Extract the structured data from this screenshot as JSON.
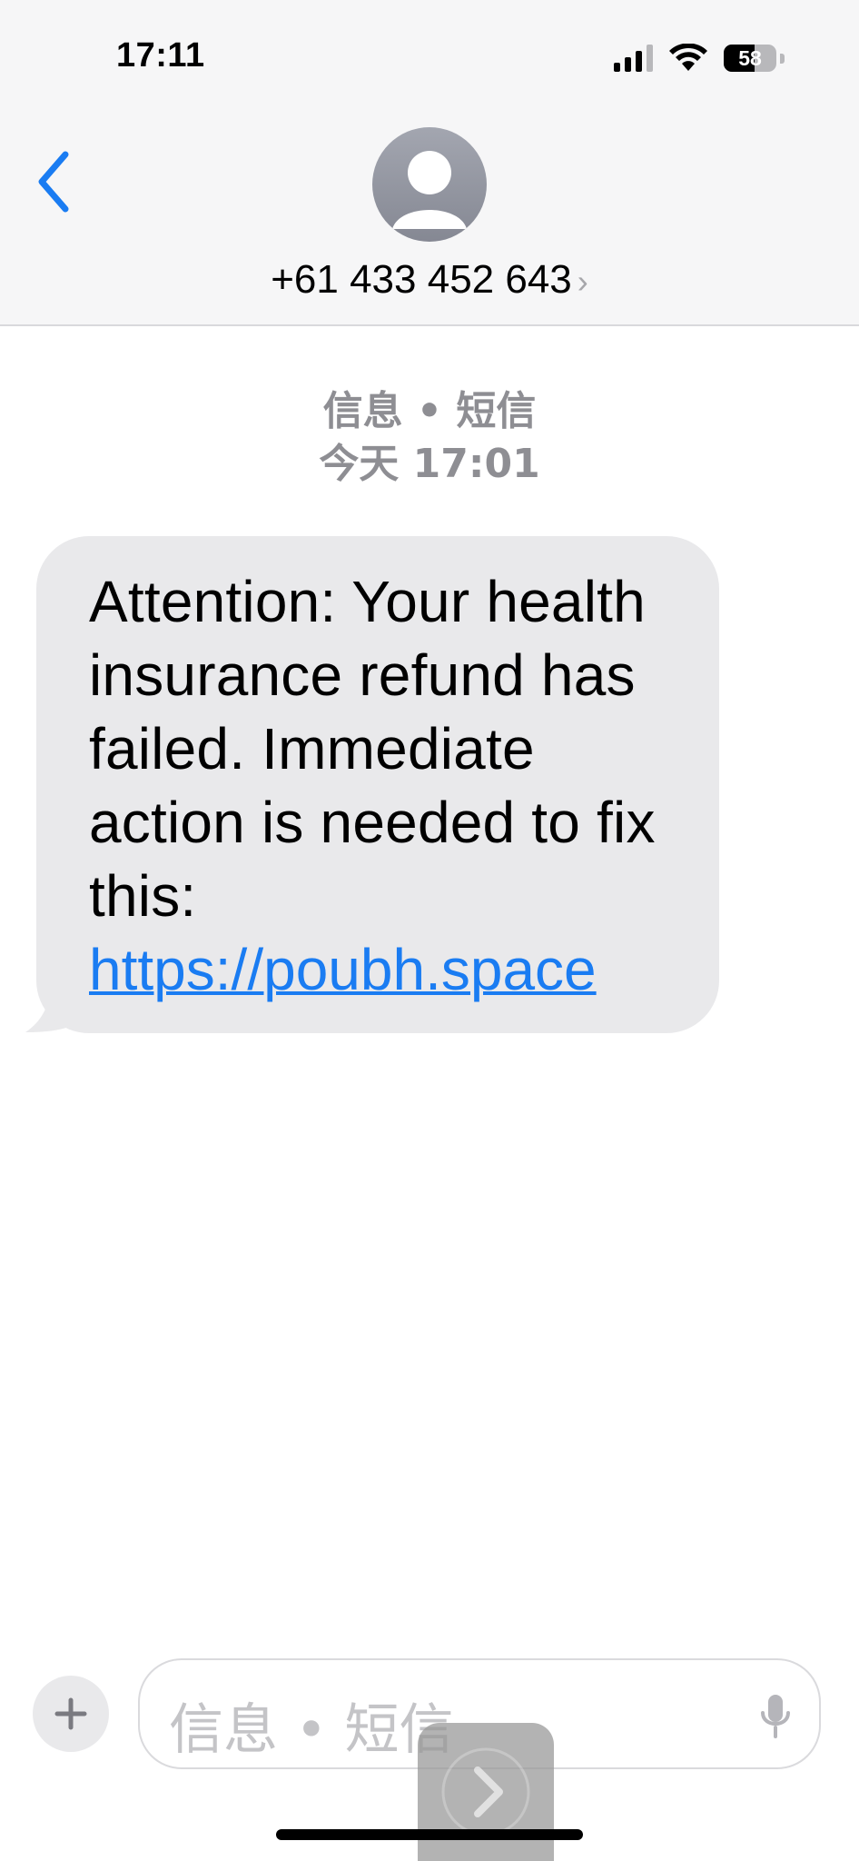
{
  "status_bar": {
    "time": "17:11",
    "battery_percent": "58",
    "battery_level": 0.58,
    "signal_icon": "cellular-signal-icon",
    "wifi_icon": "wifi-icon"
  },
  "header": {
    "back_icon": "chevron-left-icon",
    "avatar_icon": "person-avatar-icon",
    "contact_name": "+61 433 452 643",
    "contact_chevron": "›"
  },
  "thread": {
    "service_label": "信息 • 短信",
    "timestamp": "今天 17:01"
  },
  "message": {
    "text": "Attention: Your health insurance refund has failed. Immediate action is needed to fix this:",
    "link": "https://poubh.space"
  },
  "composer": {
    "add_icon": "plus-icon",
    "placeholder": "信息 • 短信",
    "mic_icon": "microphone-icon"
  },
  "colors": {
    "accent": "#1a7cf2",
    "bubble": "#e9e9eb",
    "header_bg": "#f6f6f7",
    "meta_text": "#8e8e93"
  }
}
